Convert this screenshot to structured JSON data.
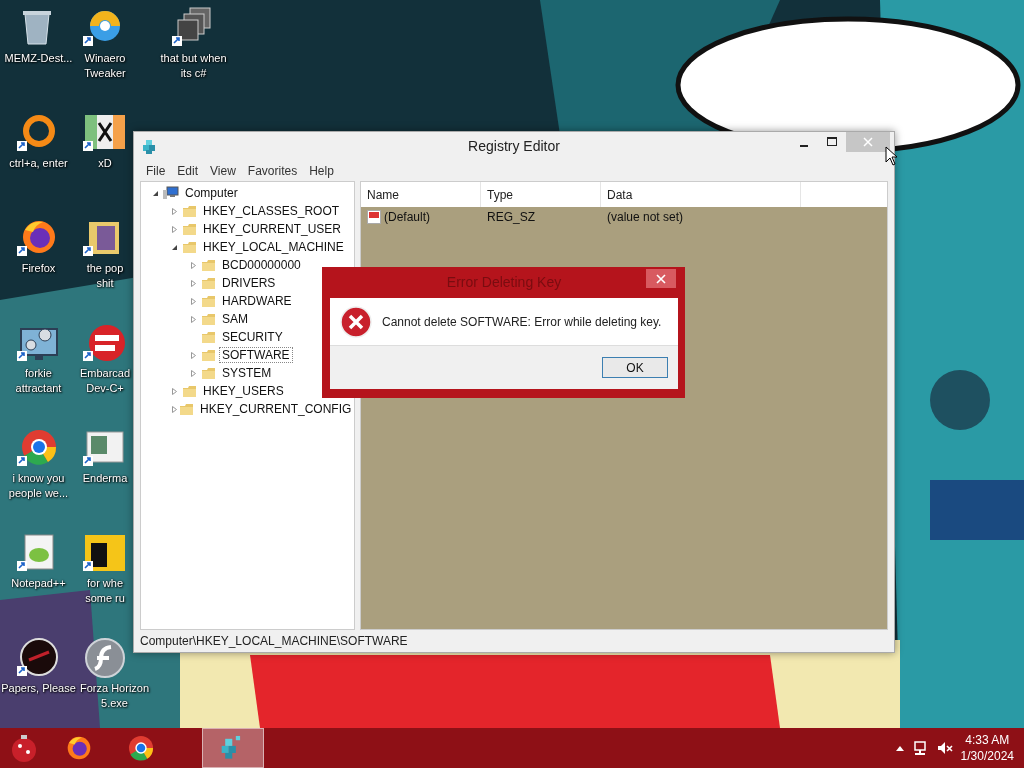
{
  "desktop_icon_columns": [
    [
      {
        "kind": "recycle-bin",
        "shortcut": false,
        "label_lines": [
          "MEMZ-Dest..."
        ]
      },
      {
        "kind": "ring",
        "shortcut": true,
        "label_lines": [
          "ctrl+a, enter"
        ]
      },
      {
        "kind": "firefox",
        "shortcut": true,
        "label_lines": [
          "Firefox"
        ]
      },
      {
        "kind": "gears",
        "shortcut": true,
        "label_lines": [
          "forkie",
          "attractant"
        ]
      },
      {
        "kind": "chrome",
        "shortcut": true,
        "label_lines": [
          "i know you",
          "people we..."
        ]
      },
      {
        "kind": "notepad",
        "shortcut": true,
        "label_lines": [
          "Notepad++"
        ]
      },
      {
        "kind": "dark-disc",
        "shortcut": true,
        "label_lines": [
          "Papers, Please"
        ]
      }
    ],
    [
      {
        "kind": "swirl",
        "shortcut": true,
        "label_lines": [
          "Winaero",
          "Tweaker"
        ]
      },
      {
        "kind": "tile",
        "shortcut": true,
        "label_lines": [
          "xD"
        ]
      },
      {
        "kind": "folder",
        "shortcut": true,
        "label_lines": [
          "the pop",
          "shit"
        ]
      },
      {
        "kind": "red-disc",
        "shortcut": true,
        "label_lines": [
          "Embarcad",
          "Dev-C+"
        ]
      },
      {
        "kind": "document",
        "shortcut": true,
        "label_lines": [
          "Enderma"
        ]
      },
      {
        "kind": "yellow-tile",
        "shortcut": true,
        "label_lines": [
          "for whe",
          "some ru"
        ]
      },
      {
        "kind": "flash-orb",
        "shortcut": false,
        "label_lines": [
          "Forza Horizon",
          "5.exe"
        ]
      }
    ],
    [
      {
        "kind": "stack",
        "shortcut": true,
        "label_lines": [
          "that but when",
          "its c#"
        ]
      }
    ]
  ],
  "registry_window": {
    "title": "Registry Editor",
    "close_hovered": true,
    "menu": [
      "File",
      "Edit",
      "View",
      "Favorites",
      "Help"
    ],
    "tree": [
      {
        "label": "Computer",
        "kind": "computer",
        "expanded": true,
        "selected": false,
        "children": [
          {
            "label": "HKEY_CLASSES_ROOT",
            "kind": "folder",
            "expanded": false,
            "selected": false
          },
          {
            "label": "HKEY_CURRENT_USER",
            "kind": "folder",
            "expanded": false,
            "selected": false
          },
          {
            "label": "HKEY_LOCAL_MACHINE",
            "kind": "folder",
            "expanded": true,
            "selected": false,
            "children": [
              {
                "label": "BCD00000000",
                "kind": "folder",
                "expanded": false,
                "selected": false
              },
              {
                "label": "DRIVERS",
                "kind": "folder",
                "expanded": false,
                "selected": false
              },
              {
                "label": "HARDWARE",
                "kind": "folder",
                "expanded": false,
                "selected": false
              },
              {
                "label": "SAM",
                "kind": "folder",
                "expanded": false,
                "selected": false
              },
              {
                "label": "SECURITY",
                "kind": "folder",
                "selected": false
              },
              {
                "label": "SOFTWARE",
                "kind": "folder",
                "expanded": false,
                "selected": true
              },
              {
                "label": "SYSTEM",
                "kind": "folder",
                "expanded": false,
                "selected": false
              }
            ]
          },
          {
            "label": "HKEY_USERS",
            "kind": "folder",
            "expanded": false,
            "selected": false
          },
          {
            "label": "HKEY_CURRENT_CONFIG",
            "kind": "folder",
            "expanded": false,
            "selected": false
          }
        ]
      }
    ],
    "columns": [
      "Name",
      "Type",
      "Data"
    ],
    "values": [
      {
        "kind": "string",
        "name": "(Default)",
        "type": "REG_SZ",
        "data": "(value not set)"
      }
    ],
    "status_bar": "Computer\\HKEY_LOCAL_MACHINE\\SOFTWARE"
  },
  "error_dialog": {
    "title": "Error Deleting Key",
    "message": "Cannot delete SOFTWARE:  Error while deleting key.",
    "buttons": [
      "OK"
    ]
  },
  "taskbar": {
    "items": [
      {
        "kind": "firefox",
        "selected": false
      },
      {
        "kind": "chrome",
        "selected": false
      },
      {
        "kind": "regedit",
        "selected": true
      }
    ],
    "tray": {
      "muted": true
    },
    "time": "4:33 AM",
    "date": "1/30/2024"
  }
}
